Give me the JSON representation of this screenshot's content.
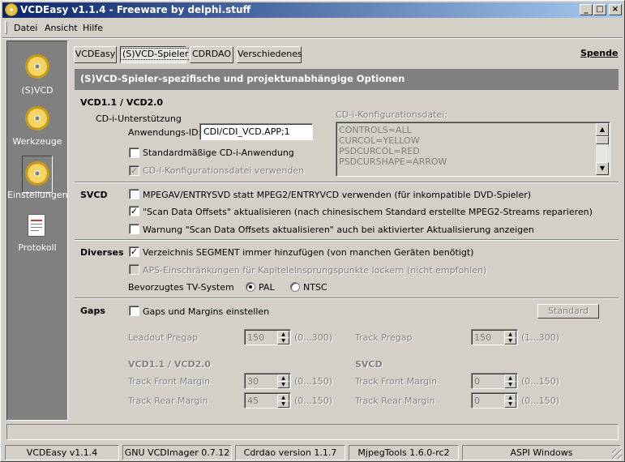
{
  "window": {
    "title": "VCDEasy v1.1.4 - Freeware by delphi.stuff",
    "controls": [
      "_",
      "□",
      "×"
    ]
  },
  "menu": [
    "Datei",
    "Ansicht",
    "Hilfe"
  ],
  "sidebar": [
    {
      "label": "(S)VCD",
      "icon": "svcd-disc-icon",
      "selected": false
    },
    {
      "label": "Werkzeuge",
      "icon": "tools-disc-icon",
      "selected": false
    },
    {
      "label": "Einstellungen",
      "icon": "settings-disc-icon",
      "selected": true
    },
    {
      "label": "Protokoll",
      "icon": "log-document-icon",
      "selected": false
    }
  ],
  "tabs": [
    "VCDEasy",
    "(S)VCD-Spieler",
    "CDRDAO",
    "Verschiedenes"
  ],
  "active_tab": "(S)VCD-Spieler",
  "spende": "Spende",
  "header": "(S)VCD-Spieler-spezifische und projektunabhängige Optionen",
  "vcd": {
    "section": "VCD1.1 / VCD2.0",
    "cdi_group": "CD-i-Unterstützung",
    "app_id_label": "Anwendungs-ID:",
    "app_id_value": "CDI/CDI_VCD.APP;1",
    "std_cdi_label": "Standardmäßige CD-i-Anwendung",
    "std_cdi_checked": false,
    "cfg_use_label": "CD-i-Konfigurationsdatei verwenden",
    "cfg_use_checked": true,
    "cfg_file_label": "CD-i-Konfigurationsdatei:",
    "cfg_lines": [
      "CONTROLS=ALL",
      "CURCOL=YELLOW",
      "PSDCURCOL=RED",
      "PSDCURSHAPE=ARROW"
    ]
  },
  "svcd": {
    "section": "SVCD",
    "opt1": {
      "label": "MPEGAV/ENTRYSVD statt MPEG2/ENTRYVCD verwenden (für inkompatible DVD-Spieler)",
      "checked": false
    },
    "opt2": {
      "label": "\"Scan Data Offsets\" aktualisieren (nach chinesischem Standard erstellte MPEG2-Streams reparieren)",
      "checked": true
    },
    "opt3": {
      "label": "Warnung \"Scan Data Offsets aktualisieren\" auch bei aktivierter Aktualisierung anzeigen",
      "checked": false
    }
  },
  "diverses": {
    "section": "Diverses",
    "opt1": {
      "label": "Verzeichnis SEGMENT immer hinzufügen (von manchen Geräten benötigt)",
      "checked": true
    },
    "opt2": {
      "label": "APS-Einschränkungen für Kapiteleinsprungspunkte lockern (nicht empfohlen)",
      "checked": false
    },
    "tv_label": "Bevorzugtes TV-System",
    "tv_options": [
      "PAL",
      "NTSC"
    ],
    "tv_selected": "PAL"
  },
  "gaps": {
    "section": "Gaps",
    "enable_label": "Gaps und Margins einstellen",
    "enable_checked": false,
    "standard_button": "Standard",
    "leadout_label": "Leadout Pregap",
    "leadout_value": "150",
    "leadout_range": "(0...300)",
    "track_pregap_label": "Track Pregap",
    "track_pregap_value": "150",
    "track_pregap_range": "(1...300)",
    "vcd_sub": "VCD1.1 / VCD2.0",
    "svcd_sub": "SVCD",
    "vcd_front_label": "Track Front Margin",
    "vcd_front_value": "30",
    "vcd_front_range": "(0...150)",
    "vcd_rear_label": "Track Rear Margin",
    "vcd_rear_value": "45",
    "vcd_rear_range": "(0...150)",
    "svcd_front_label": "Track Front Margin",
    "svcd_front_value": "0",
    "svcd_front_range": "(0...150)",
    "svcd_rear_label": "Track Rear Margin",
    "svcd_rear_value": "0",
    "svcd_rear_range": "(0...150)"
  },
  "statusbar": [
    "VCDEasy v1.1.4",
    "GNU VCDImager 0.7.12",
    "Cdrdao version 1.1.7",
    "MjpegTools 1.6.0-rc2",
    "ASPI Windows"
  ]
}
